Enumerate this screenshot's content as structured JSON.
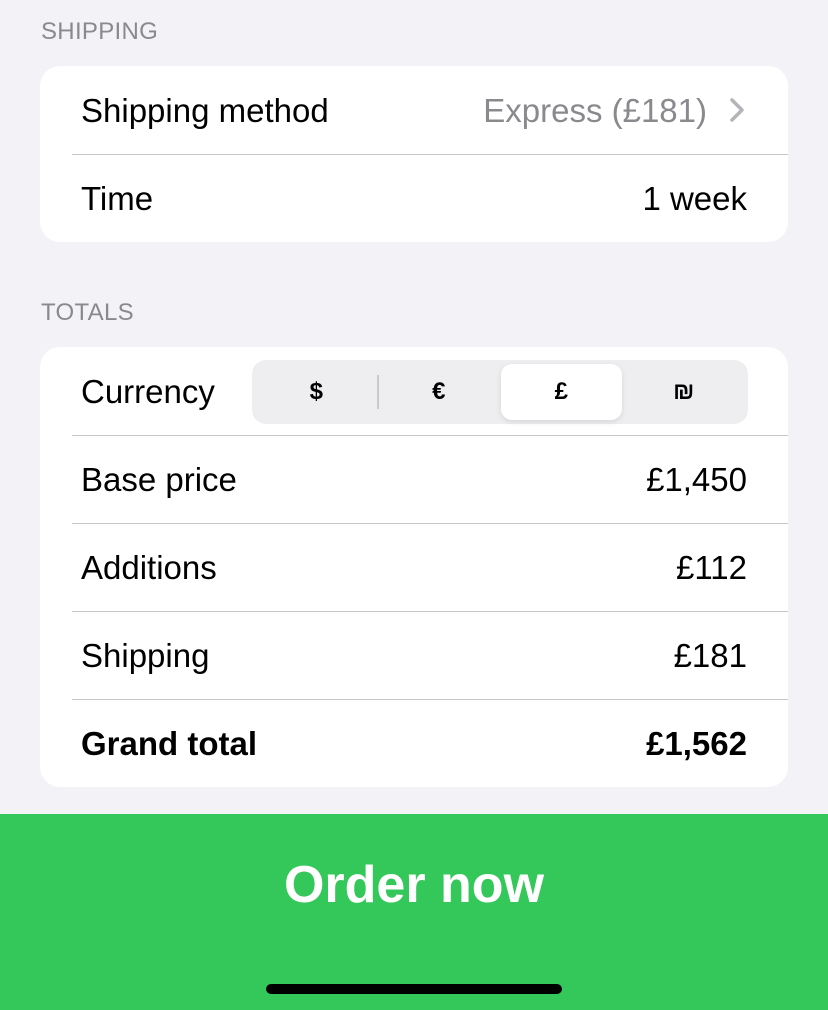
{
  "shipping": {
    "header": "SHIPPING",
    "method_label": "Shipping method",
    "method_value": "Express (£181)",
    "time_label": "Time",
    "time_value": "1 week"
  },
  "totals": {
    "header": "TOTALS",
    "currency_label": "Currency",
    "currency_options": [
      "$",
      "€",
      "£",
      "₪"
    ],
    "selected_currency": "£",
    "base_price_label": "Base price",
    "base_price_value": "£1,450",
    "additions_label": "Additions",
    "additions_value": "£112",
    "shipping_label": "Shipping",
    "shipping_value": "£181",
    "grand_total_label": "Grand total",
    "grand_total_value": "£1,562"
  },
  "order": {
    "button_label": "Order now"
  },
  "colors": {
    "background": "#f2f2f7",
    "card": "#ffffff",
    "accent_green": "#34c759",
    "muted_text": "#8a8a8e"
  },
  "icons": {
    "disclosure": "chevron-right-icon"
  }
}
